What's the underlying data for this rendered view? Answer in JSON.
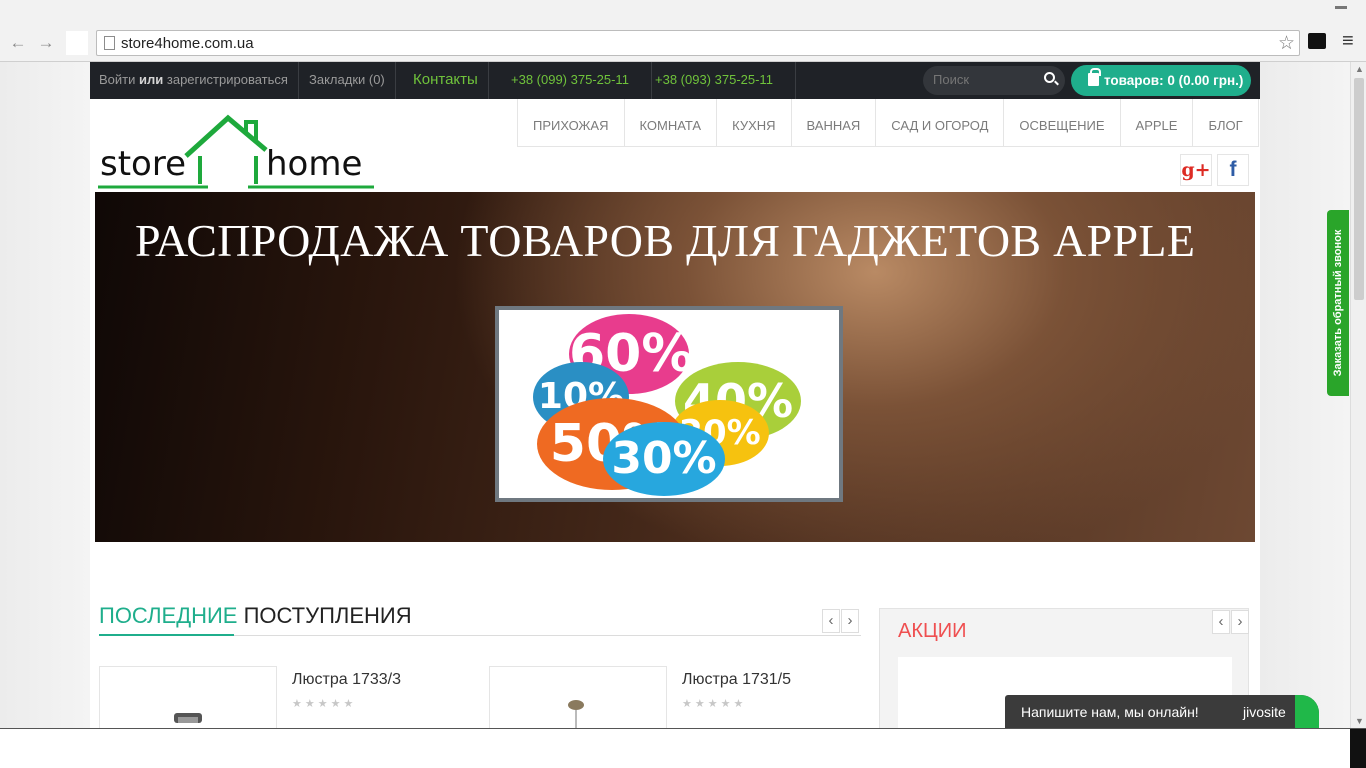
{
  "browser": {
    "url": "store4home.com.ua"
  },
  "topbar": {
    "login": "Войти",
    "or": "или",
    "register": "зарегистрироваться",
    "bookmarks": "Закладки (0)",
    "contacts": "Контакты",
    "phone1": "+38 (099) 375-25-11",
    "phone2": "+38 (093) 375-25-11",
    "search_placeholder": "Поиск",
    "cart": "товаров: 0 (0.00 грн.)"
  },
  "logo": {
    "left_word": "store",
    "right_word": "home",
    "accent_color": "#1ea93c"
  },
  "nav": {
    "items": [
      "ПРИХОЖАЯ",
      "КОМНАТА",
      "КУХНЯ",
      "ВАННАЯ",
      "САД И ОГОРОД",
      "ОСВЕЩЕНИЕ",
      "APPLE",
      "БЛОГ"
    ]
  },
  "social": {
    "google_plus": "g+",
    "facebook": "f"
  },
  "banner": {
    "title": "РАСПРОДАЖА ТОВАРОВ ДЛЯ ГАДЖЕТОВ APPLE",
    "tags": [
      "60%",
      "40%",
      "10%",
      "20%",
      "50%",
      "30%"
    ]
  },
  "latest": {
    "title_accent": "ПОСЛЕДНИЕ",
    "title_rest": "ПОСТУПЛЕНИЯ",
    "prev": "‹",
    "next": "›",
    "products": [
      {
        "name": "Люстра 1733/3",
        "rating": 0
      },
      {
        "name": "Люстра 1731/5",
        "rating": 0
      }
    ],
    "stars": "★★★★★"
  },
  "promo": {
    "title": "АКЦИИ",
    "prev": "‹",
    "next": "›"
  },
  "callback": {
    "label": "Заказать обратный звонок"
  },
  "chat": {
    "message": "Напишите нам, мы онлайн!",
    "brand": "jivosite"
  },
  "colors": {
    "accent": "#1fae8c",
    "promo_red": "#ef4f50",
    "topbar_green": "#6fc23b",
    "callback_green": "#2aa52a"
  }
}
